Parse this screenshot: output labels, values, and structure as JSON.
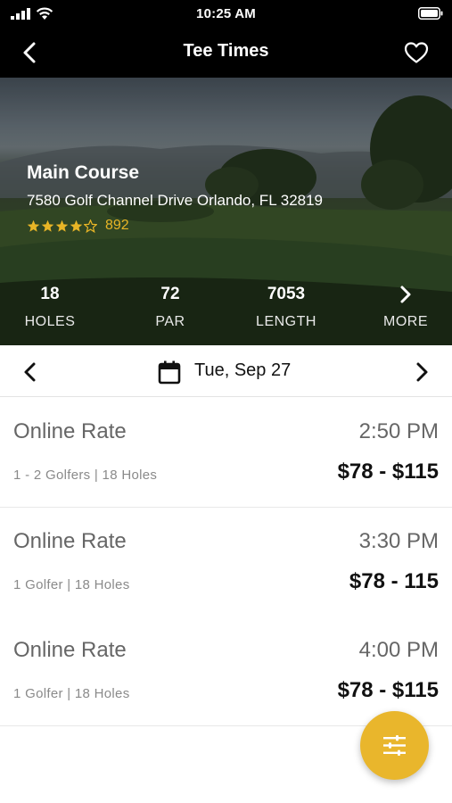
{
  "status_bar": {
    "time": "10:25 AM"
  },
  "nav": {
    "title": "Tee Times"
  },
  "course": {
    "name": "Main Course",
    "address": "7580 Golf Channel Drive Orlando, FL 32819",
    "rating_stars": 4,
    "rating_max": 5,
    "review_count": "892",
    "star_color": "#e8b526"
  },
  "stats": [
    {
      "value": "18",
      "label": "HOLES"
    },
    {
      "value": "72",
      "label": "PAR"
    },
    {
      "value": "7053",
      "label": "LENGTH"
    },
    {
      "value": "",
      "label": "MORE"
    }
  ],
  "date_picker": {
    "date": "Tue, Sep 27"
  },
  "tee_times": [
    {
      "rate": "Online Rate",
      "time": "2:50 PM",
      "details": "1 - 2 Golfers | 18 Holes",
      "price": "$78 - $115"
    },
    {
      "rate": "Online Rate",
      "time": "3:30 PM",
      "details": "1 Golfer | 18 Holes",
      "price": "$78 - 115"
    },
    {
      "rate": "Online Rate",
      "time": "4:00 PM",
      "details": "1 Golfer | 18 Holes",
      "price": "$78 - $115"
    }
  ],
  "accent_color": "#e9b62c",
  "icons": {
    "back": "chevron-left-icon",
    "favorite": "heart-outline-icon",
    "calendar": "calendar-icon",
    "filter": "sliders-icon"
  }
}
